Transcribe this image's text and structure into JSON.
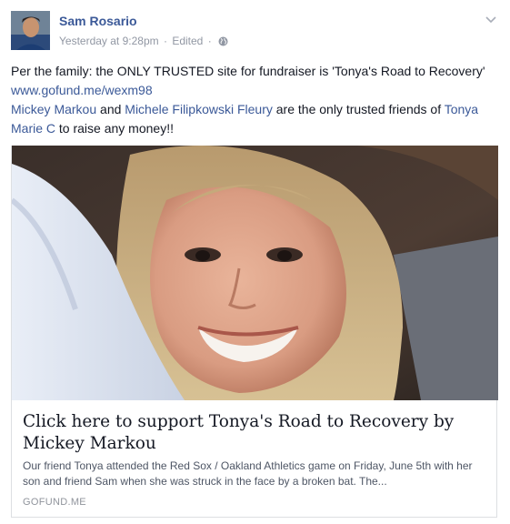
{
  "post": {
    "author": "Sam Rosario",
    "timestamp": "Yesterday at 9:28pm",
    "separator": "·",
    "edited": "Edited",
    "privacy_icon": "globe-icon",
    "options_icon": "chevron-down-icon",
    "text": {
      "line1_prefix": "Per the family: the ONLY TRUSTED site for fundraiser is 'Tonya's Road to Recovery' ",
      "link_url": "www.gofund.me/wexm98",
      "friend1": "Mickey Markou",
      "and": " and ",
      "friend2": "Michele Filipkowski Fleury",
      "middle": " are the only trusted friends of ",
      "friend3": "Tonya Marie C",
      "suffix": " to raise any money!!"
    }
  },
  "link_preview": {
    "title": "Click here to support Tonya's Road to Recovery by Mickey Markou",
    "description": "Our friend Tonya attended the Red Sox / Oakland Athletics game on Friday, June 5th with her son and friend Sam when she was struck in the face by a broken bat. The...",
    "domain": "GOFUND.ME"
  },
  "colors": {
    "link": "#3b5998",
    "text": "#141823",
    "meta": "#9197a3"
  }
}
